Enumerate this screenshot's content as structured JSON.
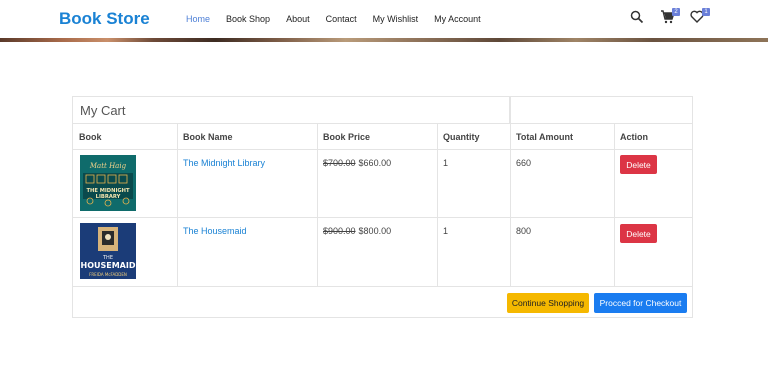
{
  "header": {
    "brand": "Book Store",
    "nav": [
      "Home",
      "Book Shop",
      "About",
      "Contact",
      "My Wishlist",
      "My Account"
    ],
    "active_nav": "Home",
    "cart_count": "2",
    "wishlist_count": "1",
    "accent_color": "#1a82d4"
  },
  "cart": {
    "title": "My Cart",
    "columns": [
      "Book",
      "Book Name",
      "Book Price",
      "Quantity",
      "Total Amount",
      "Action"
    ],
    "rows": [
      {
        "cover_title_top": "Matt Haig",
        "cover_title": "THE MIDNIGHT LIBRARY",
        "name": "The Midnight Library",
        "old_price": "$700.00",
        "price": "$660.00",
        "quantity": "1",
        "total": "660",
        "action": "Delete"
      },
      {
        "cover_title_top": "THE",
        "cover_title": "HOUSEMAID",
        "cover_author": "FREIDA McFADDEN",
        "name": "The Housemaid",
        "old_price": "$900.00",
        "price": "$800.00",
        "quantity": "1",
        "total": "800",
        "action": "Delete"
      }
    ],
    "continue_label": "Continue Shopping",
    "checkout_label": "Procced for Checkout"
  }
}
